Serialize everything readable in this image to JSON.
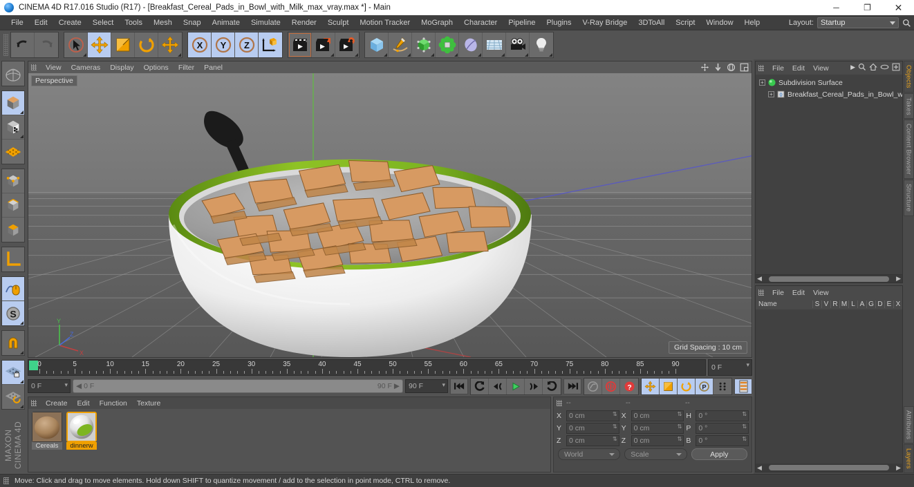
{
  "titlebar": {
    "title": "CINEMA 4D R17.016 Studio (R17) - [Breakfast_Cereal_Pads_in_Bowl_with_Milk_max_vray.max *] - Main",
    "minimize": "─",
    "maximize": "❐",
    "close": "✕"
  },
  "menubar": {
    "items": [
      {
        "label": "File"
      },
      {
        "label": "Edit"
      },
      {
        "label": "Create"
      },
      {
        "label": "Select"
      },
      {
        "label": "Tools"
      },
      {
        "label": "Mesh"
      },
      {
        "label": "Snap"
      },
      {
        "label": "Animate"
      },
      {
        "label": "Simulate"
      },
      {
        "label": "Render"
      },
      {
        "label": "Sculpt"
      },
      {
        "label": "Motion Tracker"
      },
      {
        "label": "MoGraph"
      },
      {
        "label": "Character"
      },
      {
        "label": "Pipeline"
      },
      {
        "label": "Plugins"
      },
      {
        "label": "V-Ray Bridge"
      },
      {
        "label": "3DToAll"
      },
      {
        "label": "Script"
      },
      {
        "label": "Window"
      },
      {
        "label": "Help"
      }
    ],
    "layout_label": "Layout:",
    "layout_value": "Startup"
  },
  "toolbar": {
    "groups": [
      {
        "buttons": [
          {
            "name": "undo-icon",
            "selected": false,
            "disabled": false
          },
          {
            "name": "redo-icon",
            "selected": false,
            "disabled": true
          }
        ]
      },
      {
        "buttons": [
          {
            "name": "live-selection-icon",
            "selected": false,
            "disabled": false
          },
          {
            "name": "move-tool-icon",
            "selected": true,
            "disabled": false
          },
          {
            "name": "scale-tool-icon",
            "selected": false,
            "disabled": false
          },
          {
            "name": "rotate-tool-icon",
            "selected": false,
            "disabled": false
          },
          {
            "name": "move-duplicate-icon",
            "selected": false,
            "disabled": false
          }
        ]
      },
      {
        "buttons": [
          {
            "name": "axis-x-lock-icon",
            "selected": true,
            "disabled": false
          },
          {
            "name": "axis-y-lock-icon",
            "selected": true,
            "disabled": false
          },
          {
            "name": "axis-z-lock-icon",
            "selected": true,
            "disabled": false
          },
          {
            "name": "world-object-coordinates-icon",
            "selected": true,
            "disabled": false
          }
        ]
      },
      {
        "buttons": [
          {
            "name": "render-view-icon",
            "selected": false,
            "disabled": false
          },
          {
            "name": "render-to-picture-viewer-icon",
            "selected": false,
            "disabled": false
          },
          {
            "name": "render-settings-icon",
            "selected": false,
            "disabled": false
          }
        ]
      },
      {
        "buttons": [
          {
            "name": "add-cube-object-icon",
            "selected": false,
            "disabled": false
          },
          {
            "name": "add-spline-icon",
            "selected": false,
            "disabled": false
          },
          {
            "name": "add-generator-icon",
            "selected": false,
            "disabled": false
          },
          {
            "name": "add-deformer-icon",
            "selected": false,
            "disabled": false
          },
          {
            "name": "add-scene-object-icon",
            "selected": false,
            "disabled": false
          },
          {
            "name": "add-environment-icon",
            "selected": false,
            "disabled": false
          },
          {
            "name": "add-camera-icon",
            "selected": false,
            "disabled": false
          },
          {
            "name": "add-light-icon",
            "selected": false,
            "disabled": false
          }
        ]
      }
    ]
  },
  "left_toolbar": {
    "groups": [
      {
        "buttons": [
          {
            "name": "undo-view-icon",
            "selected": false
          }
        ]
      },
      {
        "buttons": [
          {
            "name": "make-editable-icon",
            "selected": true
          },
          {
            "name": "viewport-solo-icon",
            "selected": false
          },
          {
            "name": "texture-axis-icon",
            "selected": false
          }
        ]
      },
      {
        "buttons": [
          {
            "name": "model-mode-icon",
            "selected": false
          },
          {
            "name": "object-mode-icon",
            "selected": false
          },
          {
            "name": "texture-mode-icon",
            "selected": false
          }
        ]
      },
      {
        "buttons": [
          {
            "name": "axis-modification-icon",
            "selected": false
          }
        ]
      },
      {
        "buttons": [
          {
            "name": "enable-axis-icon",
            "selected": true
          },
          {
            "name": "soft-selection-icon",
            "selected": true
          }
        ]
      },
      {
        "buttons": [
          {
            "name": "magnet-tool-icon",
            "selected": false
          }
        ]
      },
      {
        "buttons": [
          {
            "name": "workplane-lock-icon",
            "selected": true
          },
          {
            "name": "workplane-rotate-icon",
            "selected": false
          }
        ]
      }
    ],
    "brand_line1": "MAXON",
    "brand_line2": "CINEMA 4D"
  },
  "viewport": {
    "menu": [
      {
        "label": "View"
      },
      {
        "label": "Cameras"
      },
      {
        "label": "Display"
      },
      {
        "label": "Options"
      },
      {
        "label": "Filter"
      },
      {
        "label": "Panel"
      }
    ],
    "label": "Perspective",
    "grid_spacing": "Grid Spacing : 10 cm",
    "nav_icons": [
      "pan-icon",
      "dolly-icon",
      "orbit-icon",
      "maximize-view-icon"
    ],
    "axis_labels": {
      "y": "Y",
      "z": "Z",
      "x": "X"
    }
  },
  "timeline": {
    "ticks": [
      0,
      5,
      10,
      15,
      20,
      25,
      30,
      35,
      40,
      45,
      50,
      55,
      60,
      65,
      70,
      75,
      80,
      85,
      90
    ],
    "min": 0,
    "max": 90,
    "current_frame_field": "0 F",
    "playhead_frame": 0
  },
  "transport": {
    "current_frame": "0 F",
    "range_start": "0 F",
    "range_end": "90 F",
    "end_frame": "90 F",
    "buttons": [
      {
        "name": "go-to-start-icon",
        "selected": false
      },
      {
        "name": "go-to-previous-key-icon",
        "selected": false
      },
      {
        "name": "step-back-icon",
        "selected": false
      },
      {
        "name": "play-forward-icon",
        "selected": false
      },
      {
        "name": "step-forward-icon",
        "selected": false
      },
      {
        "name": "go-to-next-key-icon",
        "selected": false
      },
      {
        "name": "go-to-end-icon",
        "selected": false
      },
      {
        "name": "record-active-objects-icon",
        "selected": false
      },
      {
        "name": "autokeying-icon",
        "selected": false
      },
      {
        "name": "keyframe-selection-icon",
        "selected": false
      },
      {
        "name": "position-key-icon",
        "selected": true
      },
      {
        "name": "scale-key-icon",
        "selected": true
      },
      {
        "name": "rotation-key-icon",
        "selected": true
      },
      {
        "name": "parameter-key-icon",
        "selected": true
      },
      {
        "name": "point-level-animation-icon",
        "selected": false
      },
      {
        "name": "timeline-layout-icon",
        "selected": true
      }
    ]
  },
  "material_manager": {
    "menu": [
      {
        "label": "Create"
      },
      {
        "label": "Edit"
      },
      {
        "label": "Function"
      },
      {
        "label": "Texture"
      }
    ],
    "materials": [
      {
        "name": "Cereals",
        "selected": false
      },
      {
        "name": "dinnerw",
        "selected": true
      }
    ]
  },
  "coordinates": {
    "header_dashes": [
      "--",
      "--",
      "--"
    ],
    "rows": [
      {
        "pos_label": "X",
        "pos_value": "0 cm",
        "size_label": "X",
        "size_value": "0 cm",
        "rot_label": "H",
        "rot_value": "0 °"
      },
      {
        "pos_label": "Y",
        "pos_value": "0 cm",
        "size_label": "Y",
        "size_value": "0 cm",
        "rot_label": "P",
        "rot_value": "0 °"
      },
      {
        "pos_label": "Z",
        "pos_value": "0 cm",
        "size_label": "Z",
        "size_value": "0 cm",
        "rot_label": "B",
        "rot_value": "0 °"
      }
    ],
    "coord_system": "World",
    "mode": "Scale",
    "apply_label": "Apply"
  },
  "object_manager": {
    "menu": [
      {
        "label": "File"
      },
      {
        "label": "Edit"
      },
      {
        "label": "View"
      }
    ],
    "icons": [
      "overflow-arrow-icon",
      "search-icon",
      "home-icon",
      "eye-icon",
      "plus-box-icon"
    ],
    "tree": [
      {
        "label": "Subdivision Surface",
        "depth": 0,
        "icon": "subdivision-surface-icon"
      },
      {
        "label": "Breakfast_Cereal_Pads_in_Bowl_w",
        "depth": 1,
        "icon": "polygon-object-icon"
      }
    ]
  },
  "attribute_manager": {
    "menu": [
      {
        "label": "File"
      },
      {
        "label": "Edit"
      },
      {
        "label": "View"
      }
    ],
    "name_column": "Name",
    "columns": [
      "S",
      "V",
      "R",
      "M",
      "L",
      "A",
      "G",
      "D",
      "E",
      "X"
    ]
  },
  "right_tabs": {
    "top": [
      {
        "label": "Objects",
        "active": true
      },
      {
        "label": "Takes",
        "active": false
      },
      {
        "label": "Content Browser",
        "active": false
      },
      {
        "label": "Structure",
        "active": false
      }
    ],
    "bottom": [
      {
        "label": "Attributes",
        "active": false
      },
      {
        "label": "Layers",
        "active": true
      }
    ]
  },
  "statusbar": {
    "message": "Move: Click and drag to move elements. Hold down SHIFT to quantize movement / add to the selection in point mode, CTRL to remove."
  },
  "colors": {
    "accent_orange": "#f0a000",
    "selection_blue": "#b8ccf0",
    "green_marker": "#3fd18a",
    "bowl_green": "#7db521"
  }
}
